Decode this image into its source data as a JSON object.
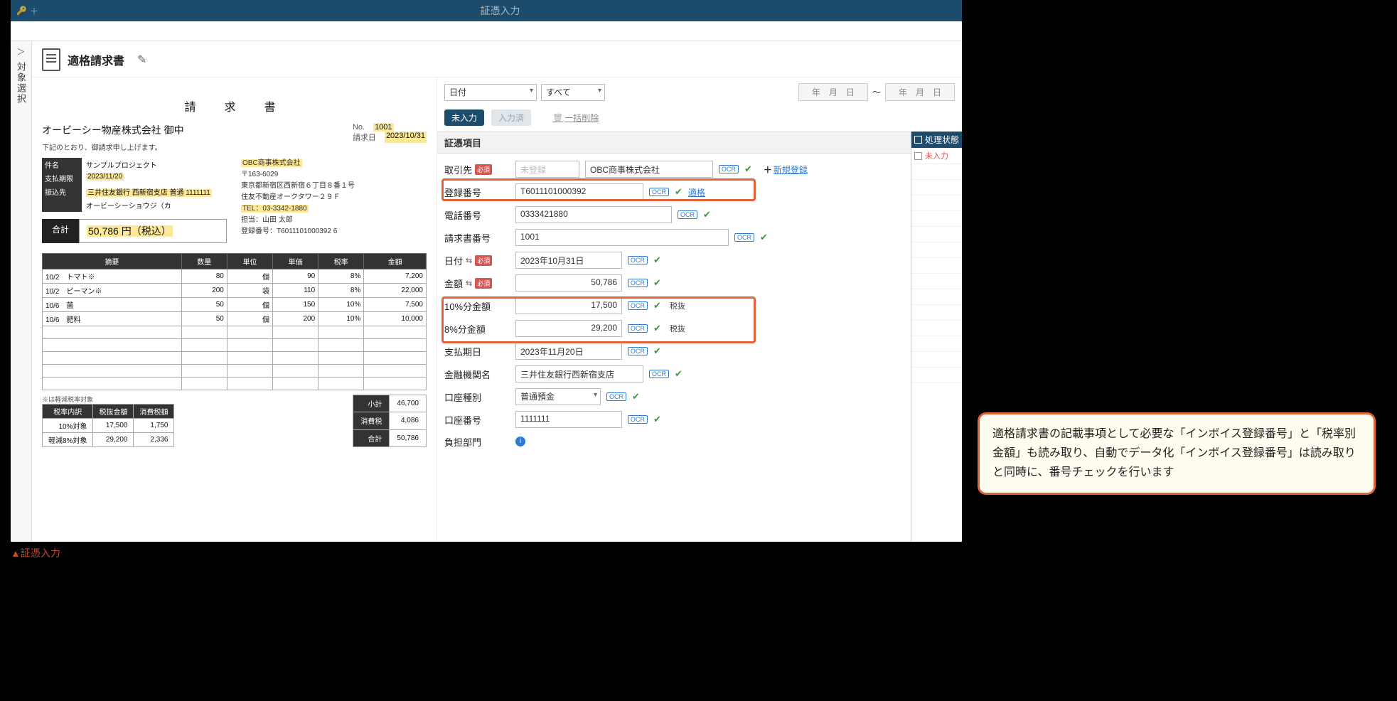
{
  "window": {
    "title": "証憑入力"
  },
  "side_tab": {
    "label": "対象選択"
  },
  "header": {
    "doc_type": "適格請求書"
  },
  "invoice": {
    "title": "請　求　書",
    "to": "オービーシー物産株式会社 御中",
    "no_label": "No.",
    "no": "1001",
    "date_label": "請求日",
    "date": "2023/10/31",
    "note": "下記のとおり、御請求申し上げます。",
    "meta": {
      "subject_label": "件名",
      "subject": "サンプルプロジェクト",
      "due_label": "支払期限",
      "due": "2023/11/20",
      "bank_label": "振込先",
      "bank": "三井住友銀行 西新宿支店 普通 1111111",
      "payee": "オービーシーショウジ（カ"
    },
    "company": {
      "name": "OBC商事株式会社",
      "zip": "〒163-6029",
      "addr1": "東京都新宿区西新宿６丁目８番１号",
      "addr2": "住友不動産オークタワー２９Ｆ",
      "tel": "TEL：03-3342-1880",
      "person": "担当：山田 太郎",
      "reg": "登録番号：T6011101000392 6"
    },
    "total_label": "合計",
    "total": "50,786 円（税込）",
    "cols": [
      "摘要",
      "数量",
      "単位",
      "単価",
      "税率",
      "金額"
    ],
    "rows": [
      {
        "d": "10/2　トマト※",
        "q": "80",
        "u": "個",
        "p": "90",
        "t": "8%",
        "a": "7,200"
      },
      {
        "d": "10/2　ピーマン※",
        "q": "200",
        "u": "袋",
        "p": "110",
        "t": "8%",
        "a": "22,000"
      },
      {
        "d": "10/6　菌",
        "q": "50",
        "u": "個",
        "p": "150",
        "t": "10%",
        "a": "7,500"
      },
      {
        "d": "10/6　肥料",
        "q": "50",
        "u": "個",
        "p": "200",
        "t": "10%",
        "a": "10,000"
      }
    ],
    "foot_note": "※は軽減税率対象",
    "tax_table": {
      "head": [
        "税率内訳",
        "税抜金額",
        "消費税額"
      ],
      "r1": [
        "10%対象",
        "17,500",
        "1,750"
      ],
      "r2": [
        "軽減8%対象",
        "29,200",
        "2,336"
      ]
    },
    "sub": {
      "subtotal_l": "小計",
      "subtotal": "46,700",
      "tax_l": "消費税",
      "tax": "4,086",
      "total_l": "合計",
      "total": "50,786"
    }
  },
  "filters": {
    "date_kind": "日付",
    "scope": "すべて",
    "from": "年　月　日",
    "tilde": "～",
    "to": "年　月　日"
  },
  "status_tabs": {
    "pending": "未入力",
    "done": "入力済",
    "bulk_delete": "一括削除"
  },
  "section_title": "証憑項目",
  "fields": {
    "partner": {
      "label": "取引先",
      "placeholder": "未登録",
      "value": "OBC商事株式会社",
      "new": "新規登録"
    },
    "regno": {
      "label": "登録番号",
      "value": "T6011101000392",
      "status": "適格"
    },
    "tel": {
      "label": "電話番号",
      "value": "0333421880"
    },
    "invno": {
      "label": "請求書番号",
      "value": "1001"
    },
    "date": {
      "label": "日付",
      "value": "2023年10月31日"
    },
    "amount": {
      "label": "金額",
      "value": "50,786"
    },
    "amt10": {
      "label": "10%分金額",
      "value": "17,500",
      "ext": "税抜"
    },
    "amt8": {
      "label": "8%分金額",
      "value": "29,200",
      "ext": "税抜"
    },
    "due": {
      "label": "支払期日",
      "value": "2023年11月20日"
    },
    "bank": {
      "label": "金融機関名",
      "value": "三井住友銀行西新宿支店"
    },
    "acct_type": {
      "label": "口座種別",
      "value": "普通預金"
    },
    "acct_no": {
      "label": "口座番号",
      "value": "1111111"
    },
    "dept": {
      "label": "負担部門"
    }
  },
  "ocr_label": "OCR",
  "status_col": {
    "header": "処理状態",
    "row1": "未入力"
  },
  "callout": "適格請求書の記載事項として必要な「インボイス登録番号」と「税率別金額」も読み取り、自動でデータ化「インボイス登録番号」は読み取りと同時に、番号チェックを行います",
  "caption": "▲証憑入力"
}
